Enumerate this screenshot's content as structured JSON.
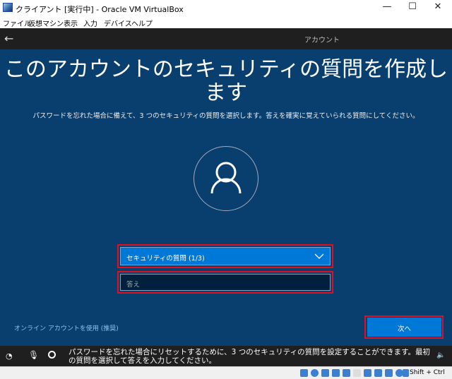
{
  "window": {
    "title": "クライアント  [実行中] - Oracle VM VirtualBox",
    "minimize": "—",
    "maximize": "☐",
    "close": "✕"
  },
  "menu": [
    "ファイル",
    "仮想マシン",
    "表示",
    "入力",
    "デバイス",
    "ヘルプ"
  ],
  "nav": {
    "back": "←",
    "tab": "アカウント"
  },
  "main": {
    "title": "このアカウントのセキュリティの質問を作成します",
    "subtitle": "パスワードを忘れた場合に備えて、3 つのセキュリティの質問を選択します。答えを確実に覚えていられる質問にしてください。",
    "question_select": "セキュリティの質問 (1/3)",
    "answer_placeholder": "答え",
    "online_link": "オンライン アカウントを使用 (推奨)",
    "next": "次へ"
  },
  "narrator": "パスワードを忘れた場合にリセットするために、3 つのセキュリティの質問を設定することができます。最初の質問を選択して答えを入力してください。",
  "status": {
    "hostkey": "Shift + Ctrl"
  }
}
